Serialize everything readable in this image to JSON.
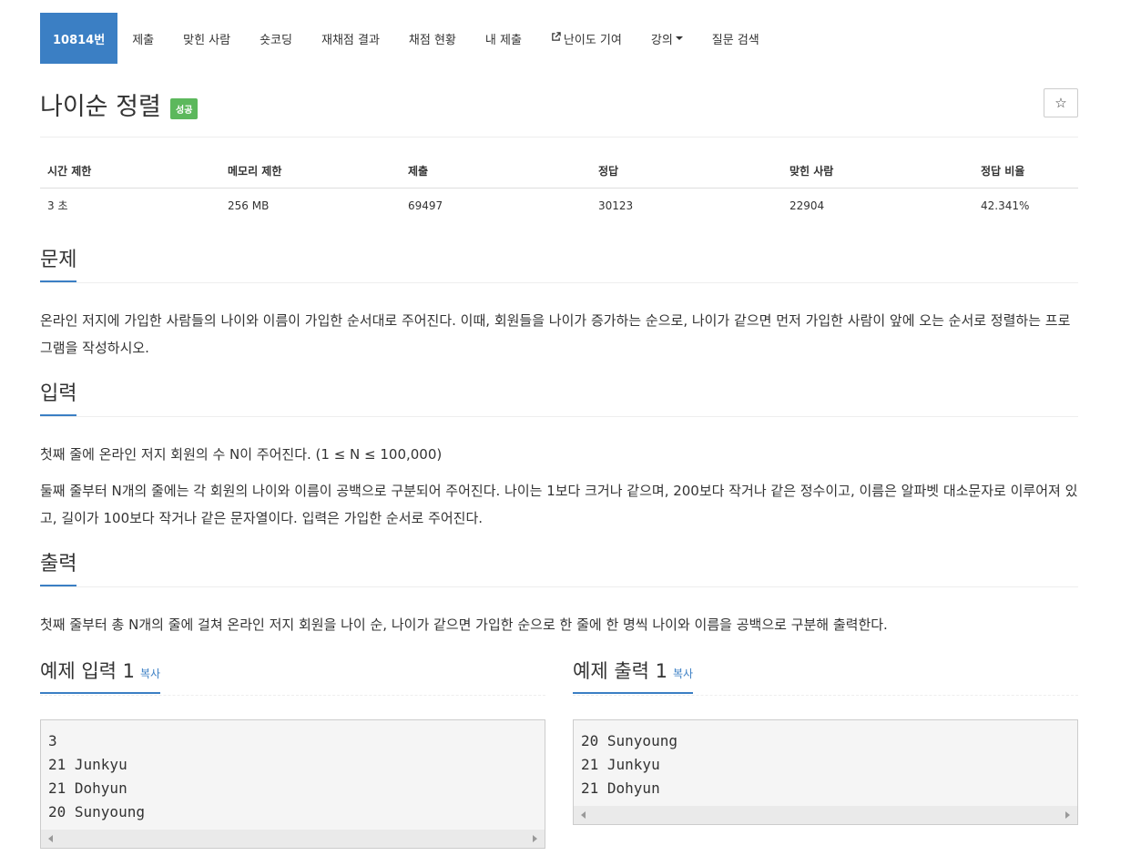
{
  "nav": {
    "items": [
      {
        "label": "10814번",
        "active": true
      },
      {
        "label": "제출"
      },
      {
        "label": "맞힌 사람"
      },
      {
        "label": "숏코딩"
      },
      {
        "label": "재채점 결과"
      },
      {
        "label": "채점 현황"
      },
      {
        "label": "내 제출"
      },
      {
        "label": "난이도 기여",
        "icon": "external-link-icon"
      },
      {
        "label": "강의",
        "icon": "caret-down-icon"
      },
      {
        "label": "질문 검색"
      }
    ]
  },
  "problem": {
    "title": "나이순 정렬",
    "badge": "성공",
    "star": "☆"
  },
  "info": {
    "headers": [
      "시간 제한",
      "메모리 제한",
      "제출",
      "정답",
      "맞힌 사람",
      "정답 비율"
    ],
    "values": [
      "3 초",
      "256 MB",
      "69497",
      "30123",
      "22904",
      "42.341%"
    ]
  },
  "sections": {
    "problem_heading": "문제",
    "problem_text": "온라인 저지에 가입한 사람들의 나이와 이름이 가입한 순서대로 주어진다. 이때, 회원들을 나이가 증가하는 순으로, 나이가 같으면 먼저 가입한 사람이 앞에 오는 순서로 정렬하는 프로그램을 작성하시오.",
    "input_heading": "입력",
    "input_text_1": "첫째 줄에 온라인 저지 회원의 수 N이 주어진다. (1 ≤ N ≤ 100,000)",
    "input_text_2": "둘째 줄부터 N개의 줄에는 각 회원의 나이와 이름이 공백으로 구분되어 주어진다. 나이는 1보다 크거나 같으며, 200보다 작거나 같은 정수이고, 이름은 알파벳 대소문자로 이루어져 있고, 길이가 100보다 작거나 같은 문자열이다. 입력은 가입한 순서로 주어진다.",
    "output_heading": "출력",
    "output_text": "첫째 줄부터 총 N개의 줄에 걸쳐 온라인 저지 회원을 나이 순, 나이가 같으면 가입한 순으로 한 줄에 한 명씩 나이와 이름을 공백으로 구분해 출력한다."
  },
  "examples": {
    "input_title": "예제 입력 1",
    "output_title": "예제 출력 1",
    "copy_label": "복사",
    "input_text": "3\n21 Junkyu\n21 Dohyun\n20 Sunyoung",
    "output_text": "20 Sunyoung\n21 Junkyu\n21 Dohyun"
  }
}
